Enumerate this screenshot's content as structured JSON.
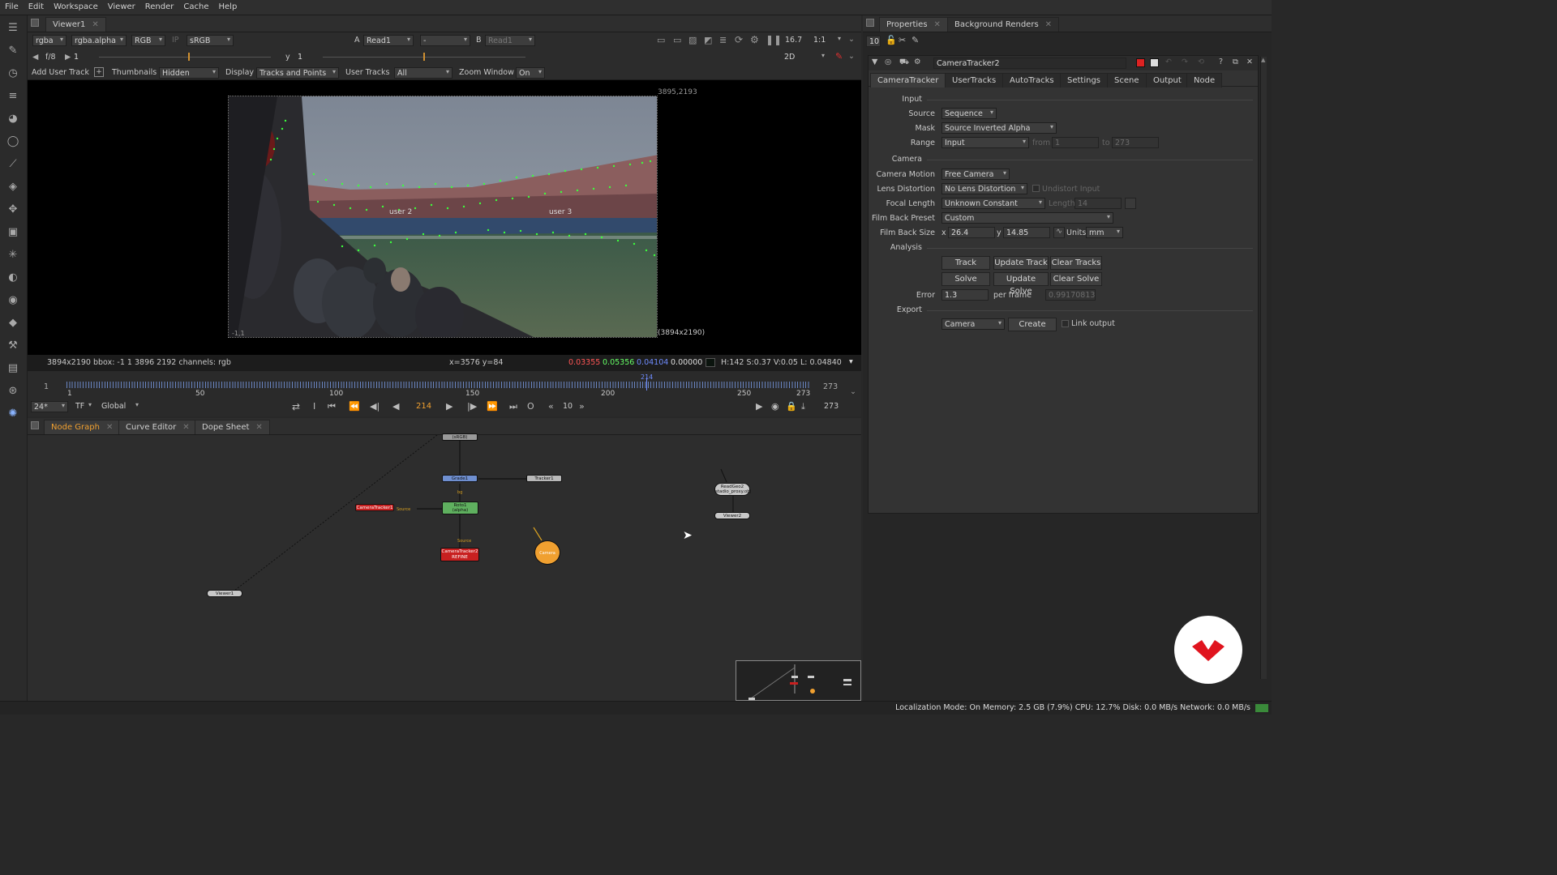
{
  "menu": [
    "File",
    "Edit",
    "Workspace",
    "Viewer",
    "Render",
    "Cache",
    "Help"
  ],
  "viewer_tab": "Viewer1",
  "viewer_controls": {
    "channels": "rgba",
    "alpha": "rgba.alpha",
    "rgb": "RGB",
    "lut": "sRGB",
    "input_a_label": "A",
    "input_a": "Read1",
    "input_mid": "-",
    "input_b_label": "B",
    "input_b": "Read1",
    "zoom": "16.7",
    "ratio": "1:1",
    "fstop": "f/8",
    "frame_field": "1",
    "y_label": "y",
    "y_field": "1",
    "mode": "2D"
  },
  "tracker_bar": {
    "add_user_track": "Add User Track",
    "thumbnails_label": "Thumbnails",
    "thumbnails": "Hidden",
    "display_label": "Display",
    "display": "Tracks and Points",
    "user_tracks_label": "User Tracks",
    "user_tracks": "All",
    "zoom_window_label": "Zoom Window",
    "zoom_window": "On"
  },
  "viewer": {
    "top_right_coord": "3895,2193",
    "bottom_right_size": "(3894x2190)",
    "bottom_left_coord": "-1,1",
    "track_labels": [
      "user 2",
      "user 3"
    ]
  },
  "info_bar": {
    "format": "3894x2190  bbox: -1 1 3896 2192 channels: rgb",
    "coords": "x=3576 y=84",
    "r": "0.03355",
    "g": "0.05356",
    "b": "0.04104",
    "a": "0.00000",
    "hsv": "H:142 S:0.37 V:0.05  L: 0.04840"
  },
  "timeline": {
    "start": "1",
    "end": "273",
    "current": "214",
    "ticks": [
      "1",
      "50",
      "100",
      "150",
      "200",
      "250",
      "273"
    ],
    "fps": "24*",
    "tf": "TF",
    "range": "Global",
    "step": "10",
    "end_field": "273"
  },
  "bottom_tabs": [
    "Node Graph",
    "Curve Editor",
    "Dope Sheet"
  ],
  "nodes": {
    "srgb": "(sRGB)",
    "grade": "Grade1",
    "tracker": "Tracker1",
    "roto": "Roto1\n(alpha)",
    "camtracker1": "CameraTracker1",
    "source1": "Source",
    "source2": "Source",
    "camtracker2": "CameraTracker2\nREFINE",
    "camera": "Camera",
    "readgeo": "ReadGeo2\nstadio_proxy.obj",
    "viewer2": "Viewer2",
    "viewer1": "Viewer1",
    "bg": "bg"
  },
  "right_tabs": [
    "Properties",
    "Background Renders"
  ],
  "props": {
    "max_panels": "10",
    "node_name": "CameraTracker2",
    "tabs": [
      "CameraTracker",
      "UserTracks",
      "AutoTracks",
      "Settings",
      "Scene",
      "Output",
      "Node"
    ],
    "input_section": "Input",
    "source_label": "Source",
    "source": "Sequence",
    "mask_label": "Mask",
    "mask": "Source Inverted Alpha",
    "range_label": "Range",
    "range": "Input",
    "from_label": "from",
    "from": "1",
    "to_label": "to",
    "to": "273",
    "camera_section": "Camera",
    "motion_label": "Camera Motion",
    "motion": "Free Camera",
    "lens_label": "Lens Distortion",
    "lens": "No Lens Distortion",
    "undistort": "Undistort Input",
    "focal_label": "Focal Length",
    "focal": "Unknown Constant",
    "length_label": "Length",
    "length": "14",
    "filmback_preset_label": "Film Back Preset",
    "filmback_preset": "Custom",
    "filmback_size_label": "Film Back Size",
    "x_label": "x",
    "x": "26.4",
    "y_label": "y",
    "y": "14.85",
    "units_label": "Units",
    "units": "mm",
    "analysis_section": "Analysis",
    "track": "Track",
    "update_track": "Update Track",
    "clear_tracks": "Clear Tracks",
    "solve": "Solve",
    "update_solve": "Update Solve",
    "clear_solve": "Clear Solve",
    "error_label": "Error",
    "error": "1.3",
    "per_frame_label": "per frame",
    "per_frame": "0.99170813",
    "export_section": "Export",
    "export": "Camera",
    "create": "Create",
    "link_output": "Link output"
  },
  "status": "Localization Mode: On Memory: 2.5 GB (7.9%) CPU: 12.7% Disk: 0.0 MB/s Network: 0.0 MB/s",
  "colors": {
    "accent": "#f0a030",
    "track_point": "#3cff3c",
    "error_red": "#ff5555",
    "green": "#66ff66",
    "blue": "#6f8cff",
    "logo_red": "#e0141e"
  }
}
